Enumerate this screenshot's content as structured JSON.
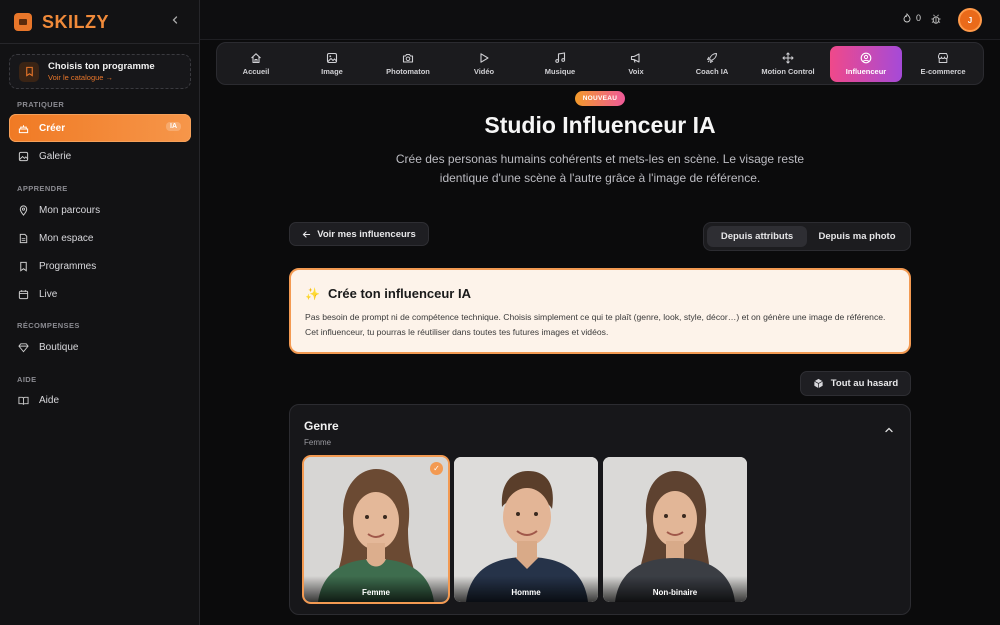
{
  "brand": {
    "name": "SKILZY"
  },
  "sidebar": {
    "program_card": {
      "title": "Choisis ton programme",
      "subtitle": "Voir le catalogue →"
    },
    "sections": [
      {
        "label": "PRATIQUER"
      },
      {
        "label": "APPRENDRE"
      },
      {
        "label": "RÉCOMPENSES"
      },
      {
        "label": "AIDE"
      }
    ],
    "items": [
      {
        "label": "Créer",
        "badge": "IA",
        "active": true
      },
      {
        "label": "Galerie"
      },
      {
        "label": "Mon parcours"
      },
      {
        "label": "Mon espace"
      },
      {
        "label": "Programmes"
      },
      {
        "label": "Live"
      },
      {
        "label": "Boutique"
      },
      {
        "label": "Aide"
      }
    ]
  },
  "topbar": {
    "credits": "0",
    "avatar_initial": "J"
  },
  "nav": {
    "tabs": [
      {
        "label": "Accueil",
        "icon": "home-icon"
      },
      {
        "label": "Image",
        "icon": "image-icon"
      },
      {
        "label": "Photomaton",
        "icon": "camera-icon"
      },
      {
        "label": "Vidéo",
        "icon": "play-icon"
      },
      {
        "label": "Musique",
        "icon": "music-icon"
      },
      {
        "label": "Voix",
        "icon": "megaphone-icon"
      },
      {
        "label": "Coach IA",
        "icon": "rocket-icon"
      },
      {
        "label": "Motion Control",
        "icon": "move-icon"
      },
      {
        "label": "Influenceur",
        "icon": "user-circle-icon",
        "active": true
      },
      {
        "label": "E-commerce",
        "icon": "store-icon"
      }
    ]
  },
  "main": {
    "badge": "NOUVEAU",
    "title": "Studio Influenceur IA",
    "description": "Crée des personas humains cohérents et mets-les en scène. Le visage reste identique d'une scène à l'autre grâce à l'image de référence.",
    "voir_button": "Voir mes influenceurs",
    "toggle": {
      "option1": "Depuis attributs",
      "option2": "Depuis ma photo",
      "active": "Depuis attributs"
    },
    "info": {
      "title": "Crée ton influenceur IA",
      "text": "Pas besoin de prompt ni de compétence technique. Choisis simplement ce qui te plaît (genre, look, style, décor…) et on génère une image de référence. Cet influenceur, tu pourras le réutiliser dans toutes tes futures images et vidéos."
    },
    "random_button": "Tout au hasard",
    "genre": {
      "title": "Genre",
      "selected": "Femme",
      "options": [
        {
          "label": "Femme",
          "selected": true
        },
        {
          "label": "Homme"
        },
        {
          "label": "Non-binaire"
        }
      ]
    }
  },
  "colors": {
    "accent": "#f07a24",
    "active_tab_gradient_start": "#f0498a",
    "active_tab_gradient_end": "#a54ad8",
    "info_bg": "#fdf3ea"
  }
}
